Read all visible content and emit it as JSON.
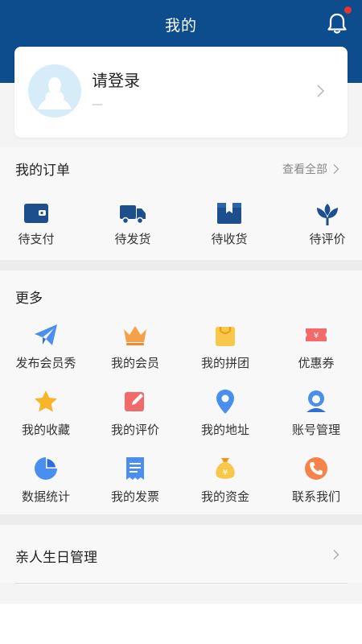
{
  "header": {
    "title": "我的"
  },
  "profile": {
    "login_text": "请登录",
    "sub_text": "—"
  },
  "orders": {
    "title": "我的订单",
    "view_all": "查看全部",
    "items": [
      {
        "label": "待支付",
        "icon": "wallet-icon"
      },
      {
        "label": "待发货",
        "icon": "truck-icon"
      },
      {
        "label": "待收货",
        "icon": "package-icon"
      },
      {
        "label": "待评价",
        "icon": "flower-icon"
      }
    ]
  },
  "more": {
    "title": "更多",
    "items": [
      {
        "label": "发布会员秀",
        "icon": "paper-plane-icon"
      },
      {
        "label": "我的会员",
        "icon": "crown-icon"
      },
      {
        "label": "我的拼团",
        "icon": "shopping-bag-icon"
      },
      {
        "label": "优惠券",
        "icon": "coupon-icon"
      },
      {
        "label": "我的收藏",
        "icon": "star-icon"
      },
      {
        "label": "我的评价",
        "icon": "edit-icon"
      },
      {
        "label": "我的地址",
        "icon": "location-icon"
      },
      {
        "label": "账号管理",
        "icon": "account-icon"
      },
      {
        "label": "数据统计",
        "icon": "pie-chart-icon"
      },
      {
        "label": "我的发票",
        "icon": "invoice-icon"
      },
      {
        "label": "我的资金",
        "icon": "money-bag-icon"
      },
      {
        "label": "联系我们",
        "icon": "phone-icon"
      }
    ]
  },
  "birthday": {
    "label": "亲人生日管理"
  },
  "colors": {
    "brand_blue": "#0d4d8e",
    "notification_red": "#e8332b",
    "order_icon_blue": "#1d4f8f"
  }
}
